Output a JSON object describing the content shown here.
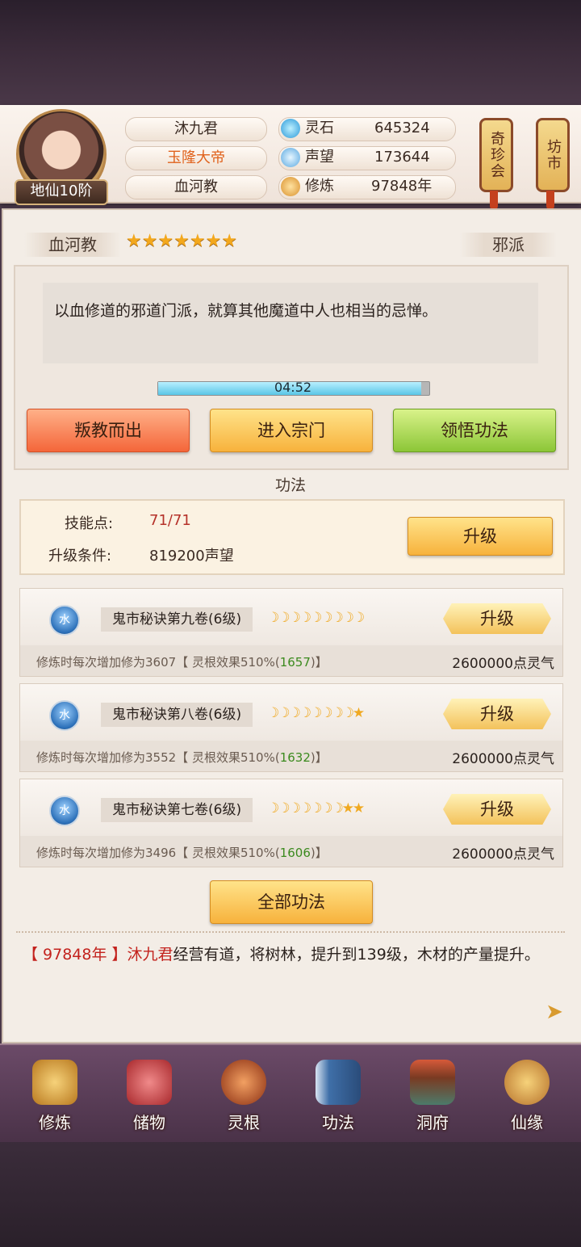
{
  "header": {
    "player_name": "沐九君",
    "title": "玉隆大帝",
    "sect": "血河教",
    "rank": "地仙10阶",
    "stats": [
      {
        "icon": "spirit-stone-icon",
        "label": "灵石",
        "value": "645324"
      },
      {
        "icon": "prestige-icon",
        "label": "声望",
        "value": "173644"
      },
      {
        "icon": "cultivation-icon",
        "label": "修炼",
        "value": "97848年"
      }
    ],
    "lanterns": [
      "奇珍会",
      "坊市"
    ]
  },
  "sect_panel": {
    "name": "血河教",
    "stars": 7,
    "type": "邪派",
    "description": "以血修道的邪道门派，就算其他魔道中人也相当的忌惮。",
    "timer": "04:52",
    "timer_progress": 0.97,
    "buttons": {
      "leave": "叛教而出",
      "enter": "进入宗门",
      "learn": "领悟功法"
    }
  },
  "techniques": {
    "section_title": "功法",
    "skill_points_label": "技能点:",
    "skill_points_value": "71/71",
    "upgrade_cond_label": "升级条件:",
    "upgrade_cond_value": "819200声望",
    "upgrade_button": "升级",
    "items": [
      {
        "element": "水",
        "name": "鬼市秘诀第九卷(6级)",
        "moons": "☽☽☽☽☽☽☽☽☽",
        "stars": "",
        "desc_pre": "修炼时每次增加修为3607【 灵根效果510%(",
        "desc_green": "1657",
        "desc_post": ")】",
        "cost": "2600000点灵气",
        "button": "升级"
      },
      {
        "element": "水",
        "name": "鬼市秘诀第八卷(6级)",
        "moons": "☽☽☽☽☽☽☽☽",
        "stars": "★",
        "desc_pre": "修炼时每次增加修为3552【 灵根效果510%(",
        "desc_green": "1632",
        "desc_post": ")】",
        "cost": "2600000点灵气",
        "button": "升级"
      },
      {
        "element": "水",
        "name": "鬼市秘诀第七卷(6级)",
        "moons": "☽☽☽☽☽☽☽",
        "stars": "★★",
        "desc_pre": "修炼时每次增加修为3496【 灵根效果510%(",
        "desc_green": "1606",
        "desc_post": ")】",
        "cost": "2600000点灵气",
        "button": "升级"
      }
    ],
    "all_button": "全部功法"
  },
  "log": {
    "year": "【 97848年 】",
    "name": "沐九君",
    "text": "经营有道，将树林，提升到139级，木材的产量提升。"
  },
  "nav": [
    {
      "label": "修炼",
      "icon": "cultivate-icon",
      "color": "#d9982e"
    },
    {
      "label": "储物",
      "icon": "storage-bag-icon",
      "color": "#c9454a"
    },
    {
      "label": "灵根",
      "icon": "spirit-root-icon",
      "color": "#c8562a"
    },
    {
      "label": "功法",
      "icon": "technique-book-icon",
      "color": "#3f6fa8"
    },
    {
      "label": "洞府",
      "icon": "cave-house-icon",
      "color": "#a0643a"
    },
    {
      "label": "仙缘",
      "icon": "gourd-icon",
      "color": "#d69a3a"
    }
  ]
}
